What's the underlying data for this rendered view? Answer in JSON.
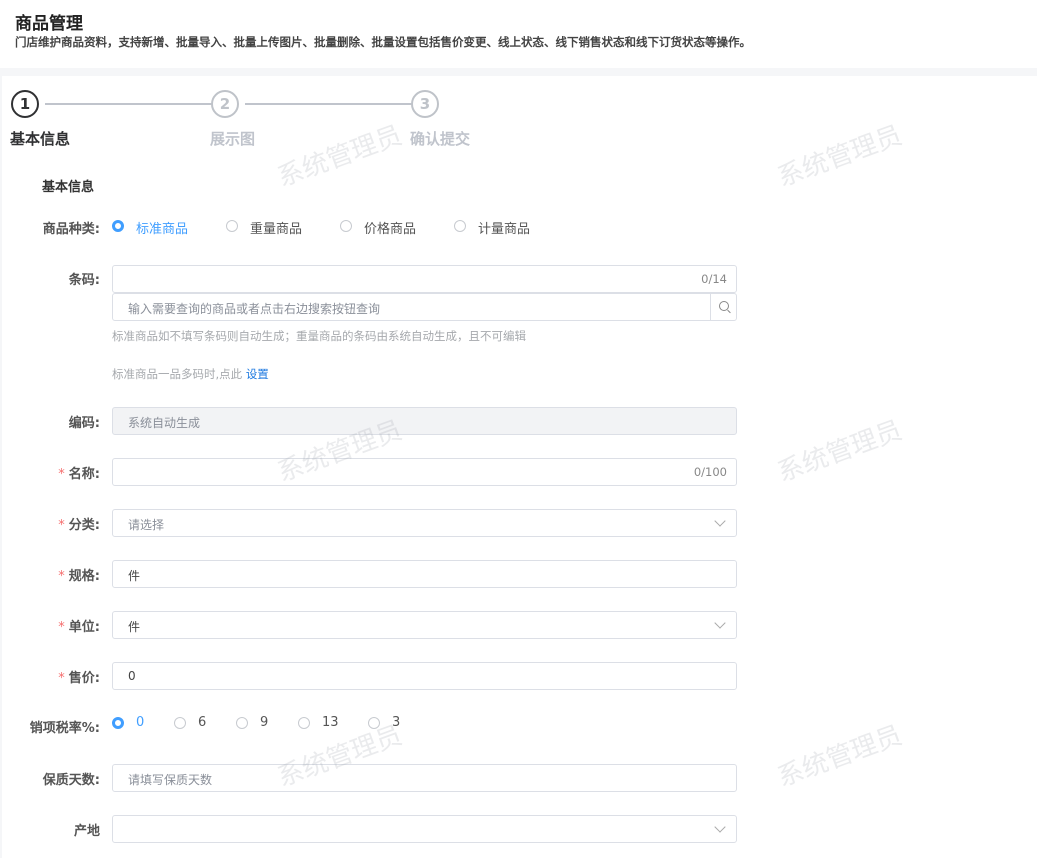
{
  "page": {
    "title": "商品管理",
    "description": "门店维护商品资料，支持新增、批量导入、批量上传图片、批量删除、批量设置包括售价变更、线上状态、线下销售状态和线下订货状态等操作。"
  },
  "steps": [
    {
      "number": "1",
      "title": "基本信息",
      "active": true
    },
    {
      "number": "2",
      "title": "展示图",
      "active": false
    },
    {
      "number": "3",
      "title": "确认提交",
      "active": false
    }
  ],
  "watermark": "系统管理员",
  "form": {
    "section_title": "基本信息",
    "product_type": {
      "label": "商品种类:",
      "options": [
        "标准商品",
        "重量商品",
        "价格商品",
        "计量商品"
      ],
      "selected": "标准商品"
    },
    "barcode": {
      "label": "条码:",
      "value": "",
      "count": "0/14",
      "search_placeholder": "输入需要查询的商品或者点击右边搜索按钮查询",
      "hint1": "标准商品如不填写条码则自动生成；重量商品的条码由系统自动生成，且不可编辑",
      "hint2": "标准商品一品多码时,点此",
      "hint2_link": "设置"
    },
    "code": {
      "label": "编码:",
      "placeholder": "系统自动生成"
    },
    "name": {
      "label": "名称:",
      "value": "",
      "count": "0/100"
    },
    "category": {
      "label": "分类:",
      "placeholder": "请选择"
    },
    "spec": {
      "label": "规格:",
      "value": "件"
    },
    "unit": {
      "label": "单位:",
      "value": "件"
    },
    "price": {
      "label": "售价:",
      "value": "0"
    },
    "tax_rate": {
      "label": "销项税率%:",
      "options": [
        "0",
        "6",
        "9",
        "13",
        "3"
      ],
      "selected": "0"
    },
    "shelf_life": {
      "label": "保质天数:",
      "placeholder": "请填写保质天数"
    },
    "origin": {
      "label": "产地",
      "value": ""
    }
  },
  "icons": {
    "search": "search-icon",
    "dropdown": "chevron-down-icon"
  },
  "colors": {
    "primary": "#409eff",
    "required": "#f56c6c",
    "link": "#1f7ae0",
    "step_active": "#303133",
    "step_inactive": "#c0c4cc"
  }
}
